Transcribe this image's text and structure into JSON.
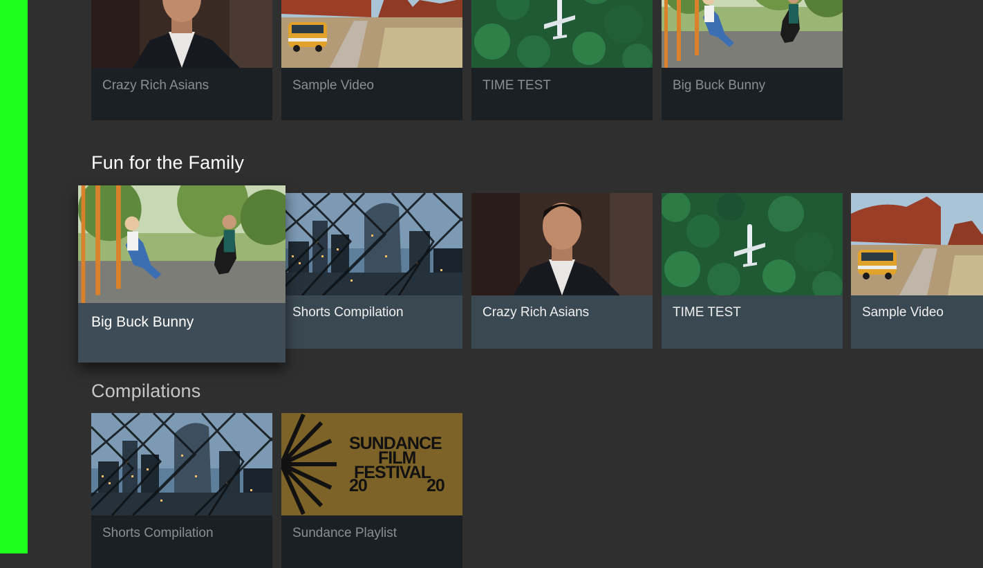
{
  "rows": [
    {
      "title": "",
      "cards": [
        {
          "title": "Crazy Rich Asians",
          "image": "portrait-man"
        },
        {
          "title": "Sample Video",
          "image": "van-desert"
        },
        {
          "title": "TIME TEST",
          "image": "forest-plane"
        },
        {
          "title": "Big Buck Bunny",
          "image": "swings"
        }
      ]
    },
    {
      "title": "Fun for the Family",
      "cards": [
        {
          "title": "Big Buck Bunny",
          "image": "swings"
        },
        {
          "title": "Shorts Compilation",
          "image": "city-net"
        },
        {
          "title": "Crazy Rich Asians",
          "image": "portrait-man"
        },
        {
          "title": "TIME TEST",
          "image": "forest-plane"
        },
        {
          "title": "Sample Video",
          "image": "van-desert"
        }
      ]
    },
    {
      "title": "Compilations",
      "cards": [
        {
          "title": "Shorts Compilation",
          "image": "city-net"
        },
        {
          "title": "Sundance Playlist",
          "image": "sundance-poster"
        }
      ]
    }
  ],
  "sundance": {
    "line1": "SUNDANCE",
    "line2": "FILM",
    "line3": "FESTIVAL",
    "year_left": "20",
    "year_right": "20"
  },
  "colors": {
    "background": "#2f2f2f",
    "nav_strip": "#1dff1d",
    "active_card": "#3a4852",
    "inactive_card": "#1b2024",
    "sundance_gold": "#7d6327"
  }
}
